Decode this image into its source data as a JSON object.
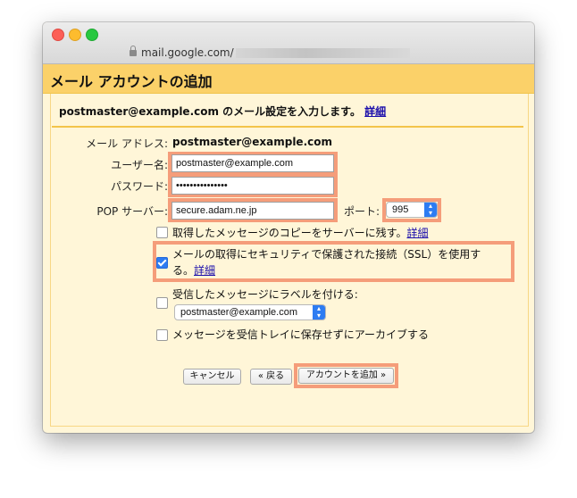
{
  "browser": {
    "url": "mail.google.com/"
  },
  "dialog": {
    "title": "メール アカウントの追加",
    "subhead_email": "postmaster@example.com",
    "subhead_text": " のメール設定を入力します。",
    "details_link": "詳細"
  },
  "form": {
    "mail_address_label": "メール アドレス:",
    "mail_address_value": "postmaster@example.com",
    "username_label": "ユーザー名:",
    "username_value": "postmaster@example.com",
    "password_label": "パスワード:",
    "password_value": "•••••••••••••••",
    "pop_server_label": "POP サーバー:",
    "pop_server_value": "secure.adam.ne.jp",
    "port_label": "ポート:",
    "port_value": "995"
  },
  "options": {
    "leave_copy": {
      "label": "取得したメッセージのコピーをサーバーに残す。",
      "link": "詳細",
      "checked": false
    },
    "ssl": {
      "label_line1": "メールの取得にセキュリティで保護された接続（SSL）を使用す",
      "label_line2": "る。",
      "link": "詳細",
      "checked": true
    },
    "label_incoming": {
      "label": "受信したメッセージにラベルを付ける:",
      "select_value": "postmaster@example.com",
      "checked": false
    },
    "archive": {
      "label": "メッセージを受信トレイに保存せずにアーカイブする",
      "checked": false
    }
  },
  "buttons": {
    "cancel": "キャンセル",
    "back": "« 戻る",
    "add_account": "アカウントを追加 »"
  },
  "colors": {
    "header_bg": "#fbd169",
    "dialog_bg": "#fff6d8",
    "highlight": "#f59d7a",
    "link": "#1a0dab"
  }
}
